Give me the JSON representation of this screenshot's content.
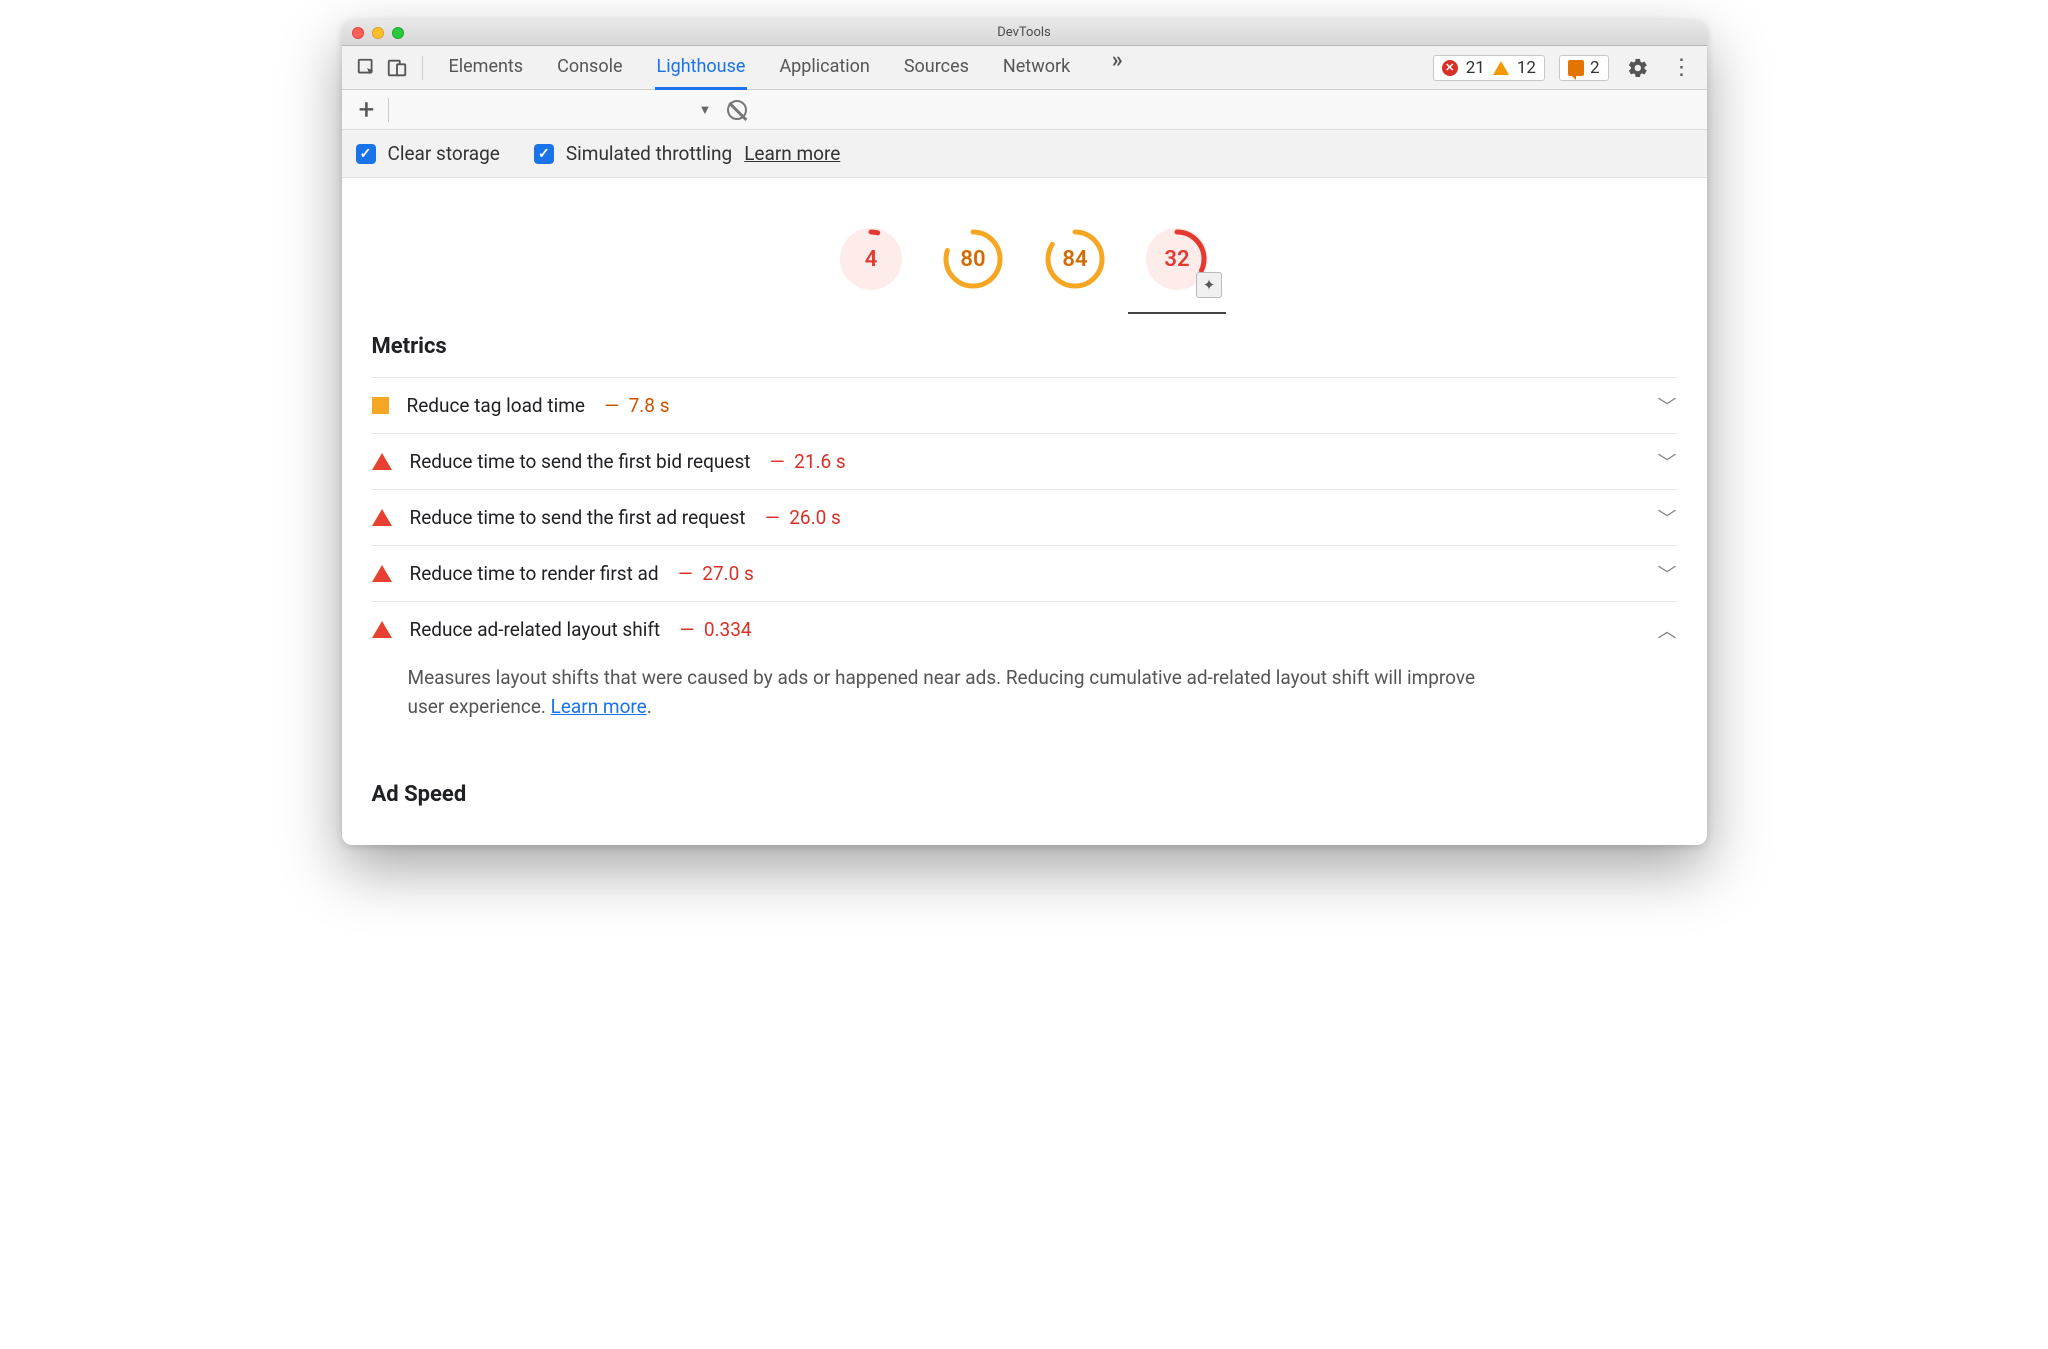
{
  "window": {
    "title": "DevTools"
  },
  "tabs": [
    "Elements",
    "Console",
    "Lighthouse",
    "Application",
    "Sources",
    "Network"
  ],
  "active_tab": "Lighthouse",
  "toolbar": {
    "errors": "21",
    "warnings": "12",
    "messages": "2"
  },
  "options": {
    "clear_storage": "Clear storage",
    "simulated_throttling": "Simulated throttling",
    "learn_more": "Learn more"
  },
  "gauges": [
    {
      "score": "4",
      "color": "red",
      "frac": 0.04
    },
    {
      "score": "80",
      "color": "orange",
      "frac": 0.8
    },
    {
      "score": "84",
      "color": "orange",
      "frac": 0.84
    },
    {
      "score": "32",
      "color": "red",
      "frac": 0.32,
      "has_plugin_badge": true,
      "selected": true
    }
  ],
  "metrics_heading": "Metrics",
  "audits": [
    {
      "status": "square",
      "title": "Reduce tag load time",
      "value": "7.8 s",
      "value_color": "orange",
      "expanded": false
    },
    {
      "status": "triangle",
      "title": "Reduce time to send the first bid request",
      "value": "21.6 s",
      "value_color": "red",
      "expanded": false
    },
    {
      "status": "triangle",
      "title": "Reduce time to send the first ad request",
      "value": "26.0 s",
      "value_color": "red",
      "expanded": false
    },
    {
      "status": "triangle",
      "title": "Reduce time to render first ad",
      "value": "27.0 s",
      "value_color": "red",
      "expanded": false
    },
    {
      "status": "triangle",
      "title": "Reduce ad-related layout shift",
      "value": "0.334",
      "value_color": "red",
      "expanded": true
    }
  ],
  "expanded_description": {
    "text_before": "Measures layout shifts that were caused by ads or happened near ads. Reducing cumulative ad-related layout shift will improve user experience. ",
    "link": "Learn more",
    "text_after": "."
  },
  "ad_speed_heading": "Ad Speed",
  "colors": {
    "red": "#e33a2f",
    "orange": "#f5a623",
    "orange_ring": "#f5a623",
    "red_bg": "#fdece9"
  }
}
